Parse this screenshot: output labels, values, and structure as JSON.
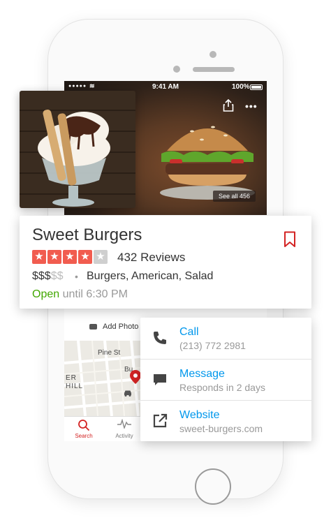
{
  "status_bar": {
    "time": "9:41 AM",
    "battery": "100%"
  },
  "hero": {
    "see_all": "See all 456"
  },
  "business": {
    "name": "Sweet Burgers",
    "rating": 4,
    "rating_max": 5,
    "reviews": "432 Reviews",
    "price_active": "$$$",
    "price_inactive": "$$",
    "categories": "Burgers, American, Salad",
    "open_label": "Open",
    "hours": "until 6:30 PM"
  },
  "actions": {
    "add_photo": "Add Photo"
  },
  "map": {
    "street_1": "Pine St",
    "street_2": "Bu",
    "neighborhood_1": "ER",
    "neighborhood_2": "HILL"
  },
  "tabbar": [
    {
      "label": "Search",
      "icon": "search-icon",
      "active": true
    },
    {
      "label": "Activity",
      "icon": "activity-icon",
      "active": false
    }
  ],
  "contact": {
    "call": {
      "label": "Call",
      "value": "(213) 772 2981",
      "icon": "phone-icon"
    },
    "message": {
      "label": "Message",
      "value": "Responds in 2 days",
      "icon": "message-icon"
    },
    "website": {
      "label": "Website",
      "value": "sweet-burgers.com",
      "icon": "external-link-icon"
    }
  },
  "colors": {
    "brand_red": "#d32323",
    "star": "#f15c4f",
    "link": "#0097ec",
    "open_green": "#41a700"
  }
}
